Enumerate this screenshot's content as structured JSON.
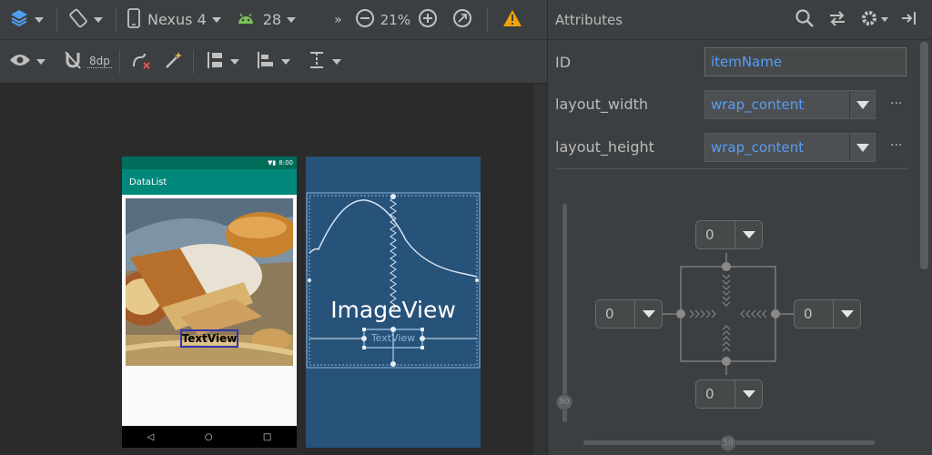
{
  "toolbar": {
    "device": "Nexus 4",
    "api_level": "28",
    "zoom": "21%",
    "margin_label": "8dp"
  },
  "phone": {
    "status_time": "8:00",
    "app_title": "DataList",
    "textview_label": "TextView"
  },
  "blueprint": {
    "imageview_label": "ImageView",
    "textview_label": "TextView"
  },
  "attributes": {
    "title": "Attributes",
    "id_label": "ID",
    "id_value": "itemName",
    "width_label": "layout_width",
    "width_value": "wrap_content",
    "height_label": "layout_height",
    "height_value": "wrap_content",
    "more": "···"
  },
  "constraints": {
    "top": "0",
    "left": "0",
    "right": "0",
    "bottom": "0",
    "vertical_bias": "90",
    "horizontal_bias": "50"
  },
  "colors": {
    "accent_blue": "#589df6",
    "warning": "#f0a30a",
    "blueprint": "#27527a",
    "app_bar": "#00897b"
  }
}
